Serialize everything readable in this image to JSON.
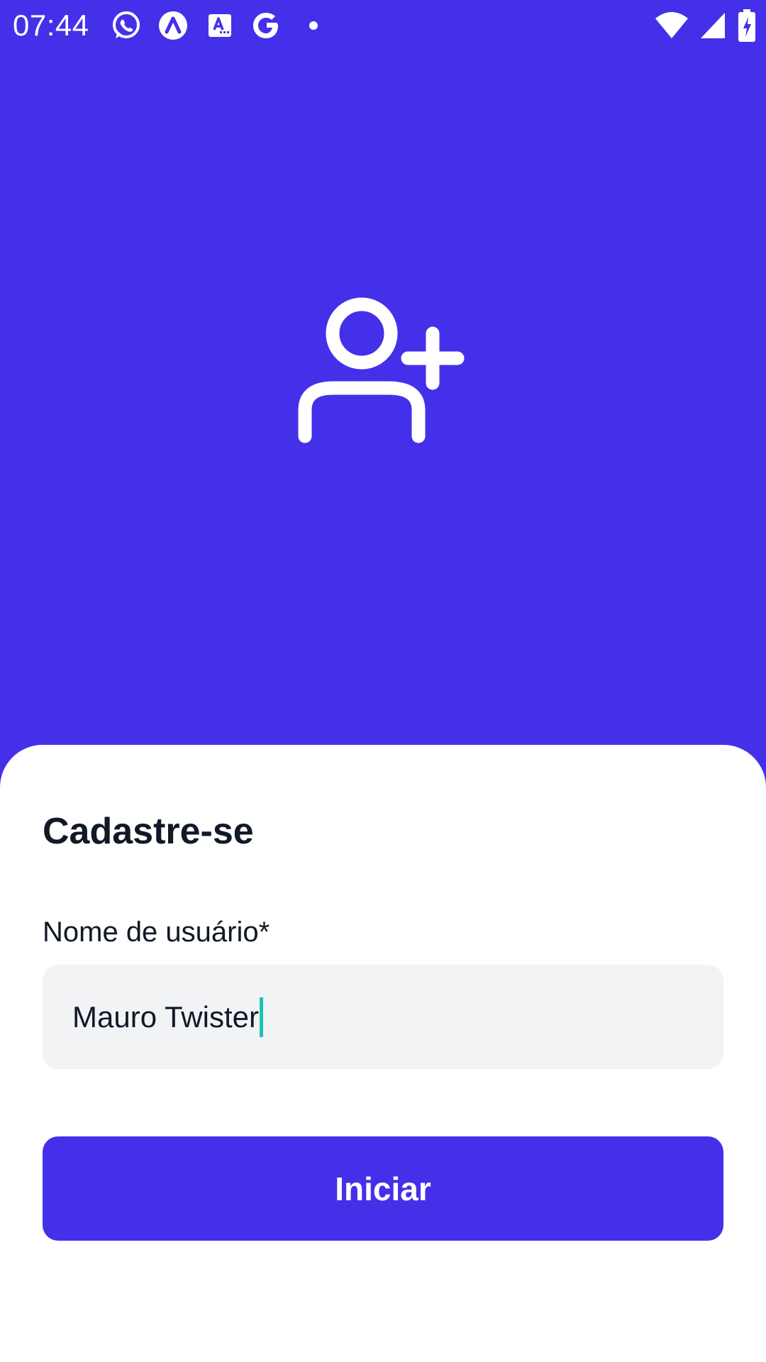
{
  "status_bar": {
    "time": "07:44",
    "left_icons": [
      "whatsapp-icon",
      "app-icon",
      "translate-icon",
      "google-icon",
      "dot-icon"
    ],
    "right_icons": [
      "wifi-icon",
      "signal-icon",
      "battery-charging-icon"
    ]
  },
  "hero": {
    "icon": "user-plus-icon"
  },
  "form": {
    "title": "Cadastre-se",
    "username_label": "Nome de usuário*",
    "username_value": "Mauro Twister",
    "submit_label": "Iniciar"
  },
  "colors": {
    "primary": "#4530E9",
    "surface": "#FFFFFF",
    "input_bg": "#F2F3F5",
    "text": "#111827",
    "caret": "#17C6B2"
  }
}
